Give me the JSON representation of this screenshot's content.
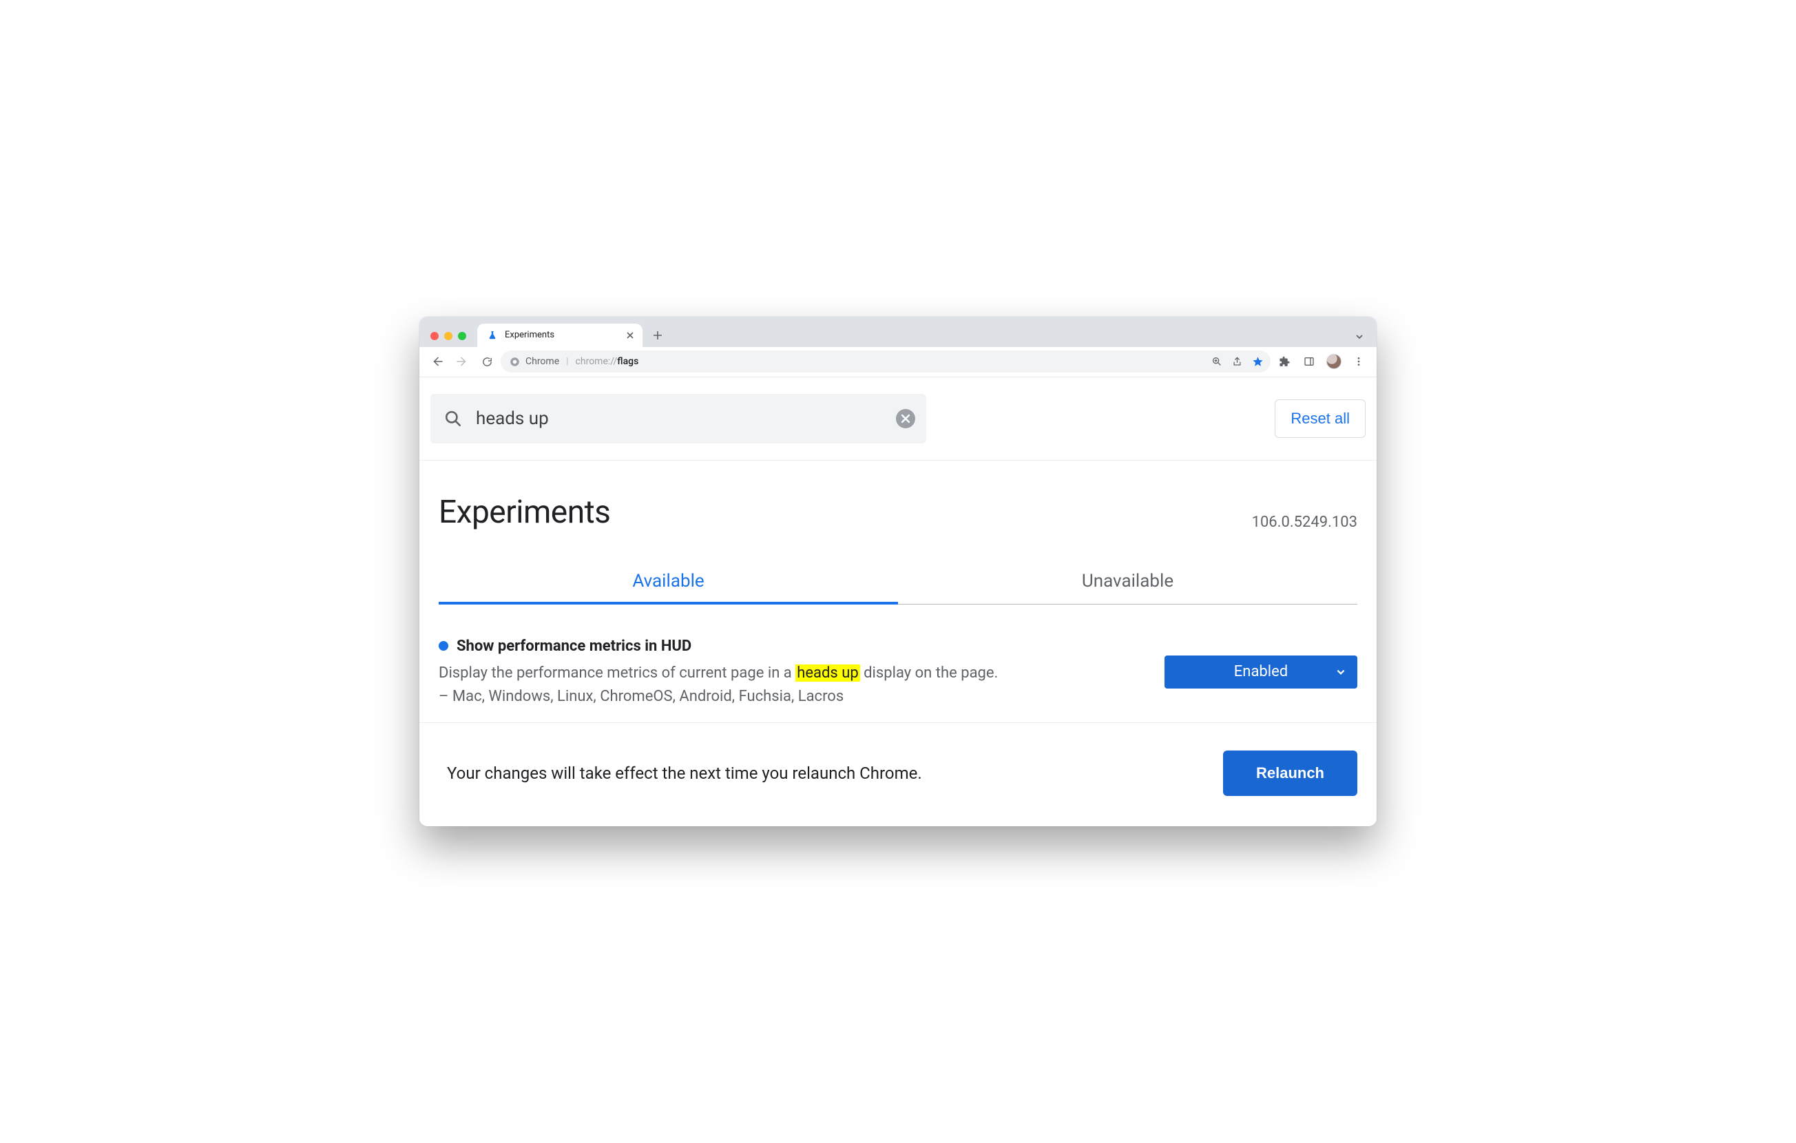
{
  "window": {
    "tab_title": "Experiments"
  },
  "omnibox": {
    "origin": "Chrome",
    "scheme": "chrome://",
    "path_strong": "flags"
  },
  "search": {
    "value": "heads up",
    "reset_label": "Reset all"
  },
  "header": {
    "title": "Experiments",
    "version": "106.0.5249.103"
  },
  "tabs": {
    "available": "Available",
    "unavailable": "Unavailable"
  },
  "flag": {
    "title": "Show performance metrics in HUD",
    "desc_pre": "Display the performance metrics of current page in a ",
    "desc_hl": "heads up",
    "desc_post": " display on the page. – Mac, Windows, Linux, ChromeOS, Android, Fuchsia, Lacros",
    "select_value": "Enabled"
  },
  "footer": {
    "message": "Your changes will take effect the next time you relaunch Chrome.",
    "relaunch_label": "Relaunch"
  }
}
